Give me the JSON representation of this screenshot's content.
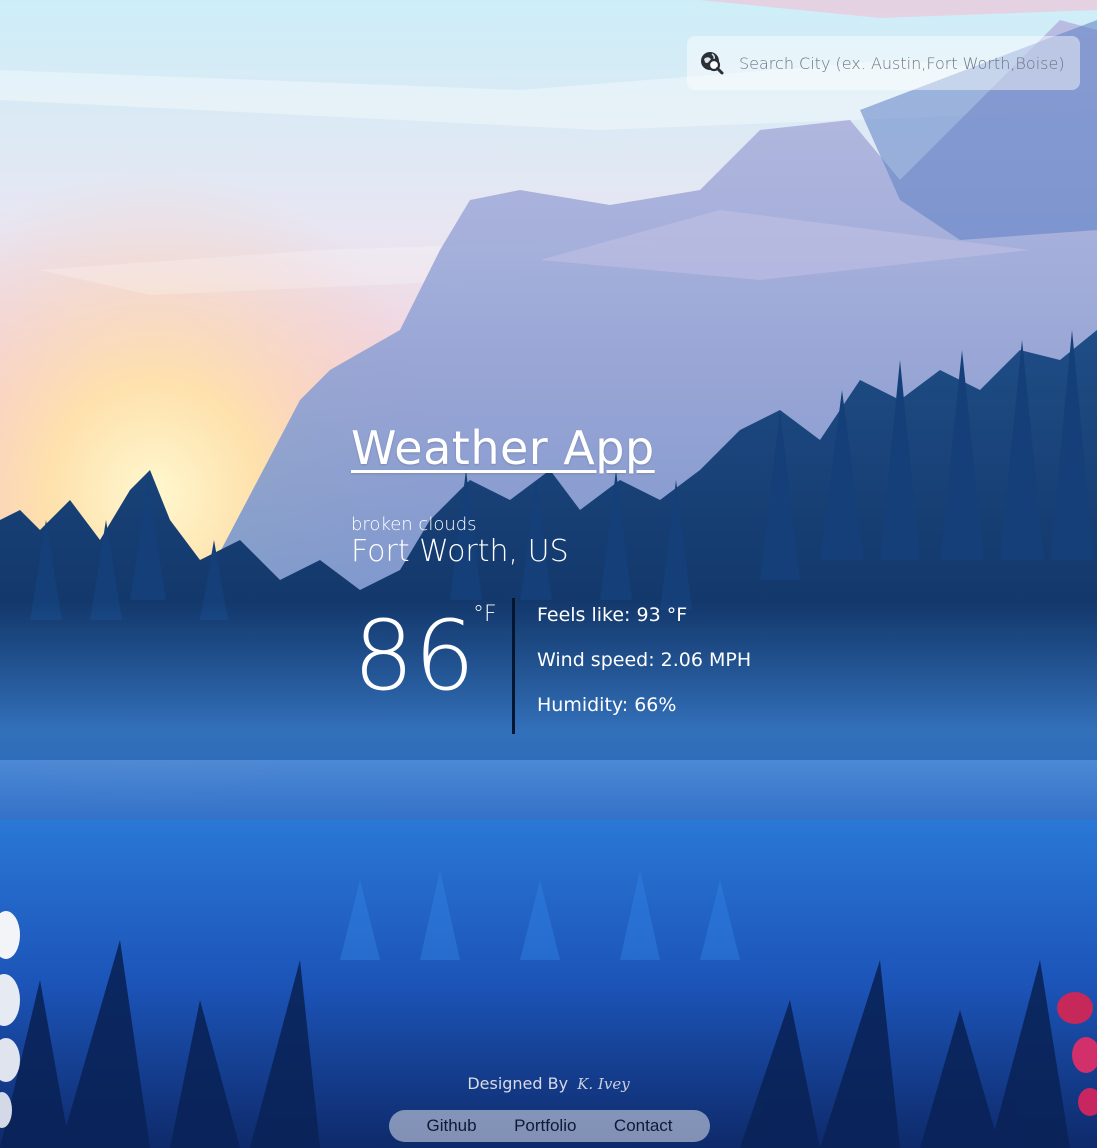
{
  "search": {
    "placeholder": "Search City (ex. Austin,Fort Worth,Boise)",
    "icon": "search-location-icon"
  },
  "app": {
    "title": "Weather App"
  },
  "weather": {
    "description": "broken clouds",
    "location": "Fort Worth, US",
    "temperature": "86",
    "unit": "°F",
    "feels_like": "Feels like: 93 °F",
    "wind_speed": "Wind speed: 2.06 MPH",
    "humidity": "Humidity: 66%"
  },
  "footer": {
    "designed_by": "Designed By",
    "signature": "K. Ivey",
    "links": [
      "Github",
      "Portfolio",
      "Contact"
    ]
  },
  "colors": {
    "divider": "#061530",
    "sky_top": "#cdeef8",
    "sky_glow": "#f7c9c9",
    "forest": "#0f3a6e",
    "grass": "#1c5fc0"
  }
}
